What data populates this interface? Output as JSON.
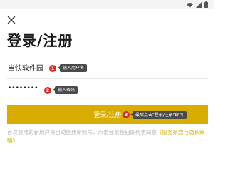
{
  "title": "登录/注册",
  "username": {
    "value": "当快软件园"
  },
  "password": {
    "value": "••••••••"
  },
  "login_button": {
    "label": "登录/注册"
  },
  "hint": {
    "prefix": "首次登陆的新用户将自动创建新账号，点击登录按钮即代表同意",
    "link": "《服务条款与隐私策略》"
  },
  "annotations": [
    {
      "number": "1",
      "text": "输入用户名"
    },
    {
      "number": "2",
      "text": "输入密码"
    },
    {
      "number": "3",
      "text": "最后点击\"登录/注册\"即可"
    }
  ],
  "colors": {
    "accent": "#d6ad00",
    "badge": "#d82a2a",
    "tooltip": "#4a4a4a"
  },
  "icons": [
    "wifi-icon",
    "signal-icon",
    "battery-icon",
    "close-icon"
  ]
}
